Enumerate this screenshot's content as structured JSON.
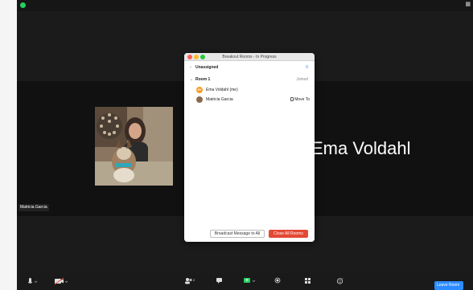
{
  "meeting": {
    "active_speaker": "Ema Voldahl",
    "participant_tile_name": "Matricia Garcia"
  },
  "dialog": {
    "title": "Breakout Rooms - In Progress",
    "unassigned_label": "Unassigned",
    "unassigned_count": "0",
    "room_label": "Room 1",
    "room_status": "Joined",
    "participants": [
      {
        "initials": "EV",
        "name": "Ema Voldahl (me)",
        "action": ""
      },
      {
        "initials": "",
        "name": "Matricia Garcia",
        "action": "Move To"
      }
    ],
    "broadcast_label": "Broadcast Message to All",
    "close_all_label": "Close All Rooms"
  },
  "toolbar": {
    "leave_label": "Leave Room"
  },
  "colors": {
    "accent": "#2d8cff",
    "danger": "#e34935",
    "meeting_bg": "#1b1b1b",
    "security_green": "#23d160"
  },
  "icons": [
    "microphone-icon",
    "video-icon",
    "participants-icon",
    "chat-icon",
    "share-screen-icon",
    "record-icon",
    "breakout-rooms-icon",
    "reactions-icon",
    "shield-icon",
    "move-to-icon"
  ]
}
